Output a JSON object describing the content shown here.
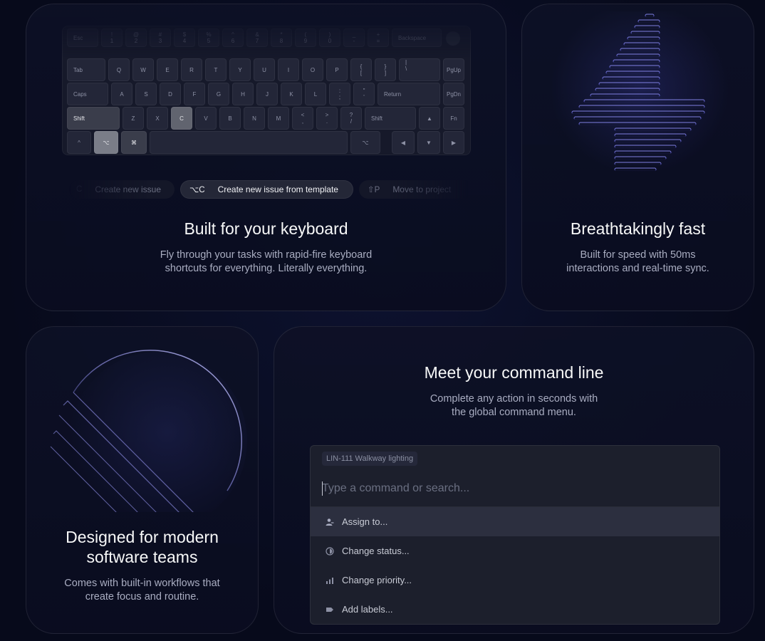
{
  "keyboard_card": {
    "title": "Built for your keyboard",
    "description_line1": "Fly through your tasks with rapid-fire keyboard",
    "description_line2": "shortcuts for everything. Literally everything.",
    "keys": {
      "row0": [
        "Esc",
        "!",
        "1",
        "@",
        "2",
        "#",
        "3",
        "$",
        "4",
        "%",
        "5",
        "^",
        "6",
        "&",
        "7",
        "*",
        "8",
        "(",
        "9",
        ")",
        "0",
        "_",
        "-",
        "+",
        "=",
        "Backspace"
      ],
      "row1": [
        "Tab",
        "Q",
        "W",
        "E",
        "R",
        "T",
        "Y",
        "U",
        "I",
        "O",
        "P",
        "{",
        "[",
        "}",
        "]",
        "|",
        "\\",
        "PgUp"
      ],
      "row2": [
        "Caps",
        "A",
        "S",
        "D",
        "F",
        "G",
        "H",
        "J",
        "K",
        "L",
        ":",
        ";",
        "\"",
        "'",
        "Return",
        "PgDn"
      ],
      "row3": [
        "Shift",
        "Z",
        "X",
        "C",
        "V",
        "B",
        "N",
        "M",
        "<",
        ",",
        ">",
        ".",
        "?",
        "/",
        "Shift",
        "▲",
        "Fn"
      ],
      "row4": [
        "^",
        "⌥",
        "⌘",
        "⌥",
        "◀",
        "▼",
        "▶"
      ]
    },
    "shortcuts": [
      {
        "key": "C",
        "label": "Create new issue"
      },
      {
        "key": "⌥C",
        "label": "Create new issue from template"
      },
      {
        "key": "⇧P",
        "label": "Move to project"
      }
    ]
  },
  "fast_card": {
    "title": "Breathtakingly fast",
    "description_line1": "Built for speed with 50ms",
    "description_line2": "interactions and real-time sync."
  },
  "teams_card": {
    "title_line1": "Designed for modern",
    "title_line2": "software teams",
    "description_line1": "Comes with built-in workflows that",
    "description_line2": "create focus and routine."
  },
  "command_card": {
    "title": "Meet your command line",
    "description_line1": "Complete any action in seconds with",
    "description_line2": "the global command menu.",
    "issue_tag": "LIN-111 Walkway lighting",
    "input_placeholder": "Type a command or search...",
    "menu_items": [
      {
        "label": "Assign to...",
        "icon": "assignee-icon"
      },
      {
        "label": "Change status...",
        "icon": "status-icon"
      },
      {
        "label": "Change priority...",
        "icon": "priority-icon"
      },
      {
        "label": "Add labels...",
        "icon": "label-icon"
      }
    ]
  },
  "colors": {
    "background": "#070a1b",
    "card_border": "#1d2034",
    "accent_purple": "#6f6ff0",
    "text_primary": "#f7f8f8",
    "text_secondary": "#a9adc1"
  }
}
